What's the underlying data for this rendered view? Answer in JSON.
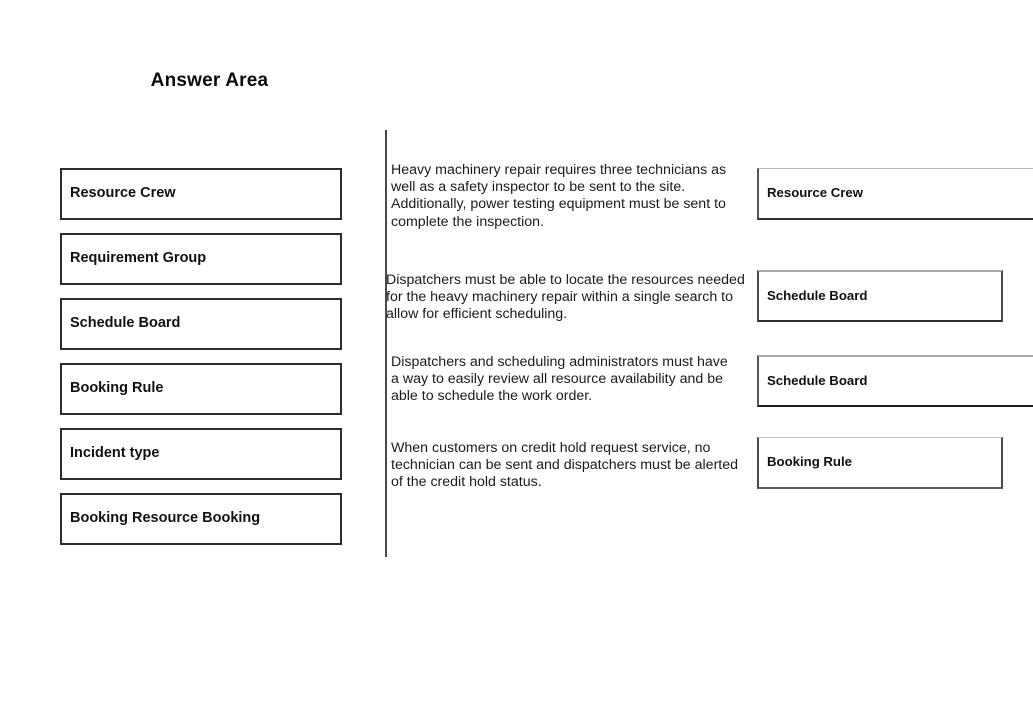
{
  "header": {
    "title": "Answer Area"
  },
  "source_options": {
    "items": [
      {
        "label": "Resource Crew"
      },
      {
        "label": "Requirement Group"
      },
      {
        "label": "Schedule Board"
      },
      {
        "label": "Booking Rule"
      },
      {
        "label": "Incident type"
      },
      {
        "label": "Booking Resource Booking"
      }
    ]
  },
  "requirements": {
    "items": [
      {
        "text": "Heavy machinery repair requires three technicians as well as a safety inspector to be sent to the site. Additionally, power testing equipment must be sent to complete the inspection."
      },
      {
        "text": "Dispatchers must be able to locate the resources needed for the heavy machinery repair within a single search to allow for efficient scheduling."
      },
      {
        "text": "Dispatchers and scheduling administrators must have a way to easily review all resource availability and be able to schedule the work order."
      },
      {
        "text": "When customers on credit hold request service, no technician can be sent and dispatchers must be alerted of the credit hold status."
      }
    ]
  },
  "answer_slots": {
    "items": [
      {
        "label": "Resource Crew"
      },
      {
        "label": "Schedule Board"
      },
      {
        "label": "Schedule Board"
      },
      {
        "label": "Booking Rule"
      }
    ]
  },
  "colors": {
    "page_background": "#ffffff",
    "box_border": "#2c2c2c",
    "divider": "#4a4a4a",
    "text": "#111111"
  }
}
